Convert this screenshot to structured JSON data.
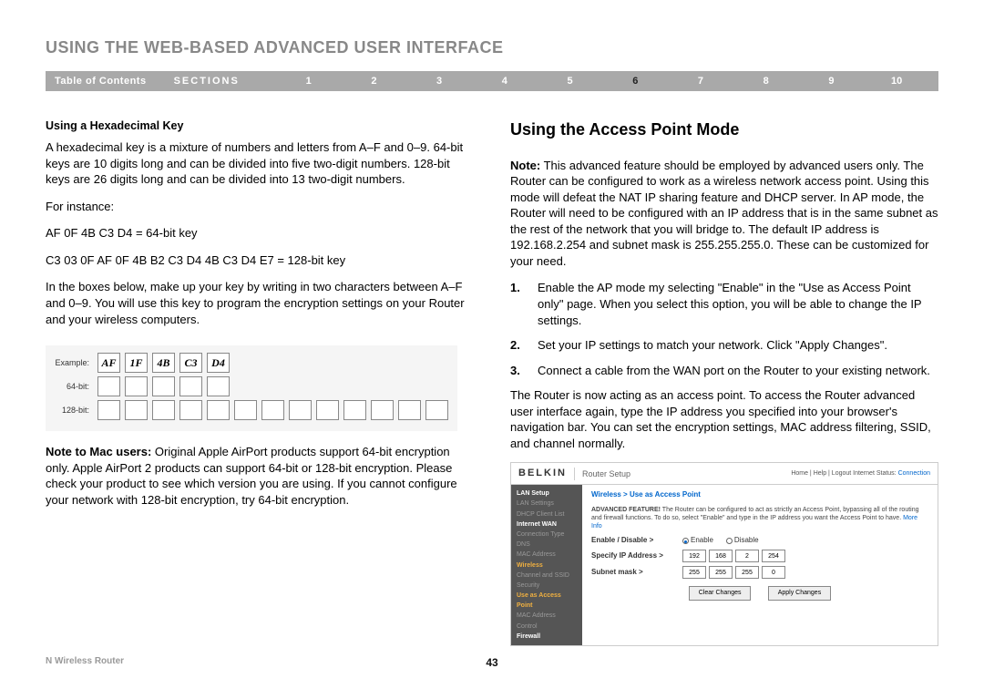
{
  "page_title": "USING THE WEB-BASED ADVANCED USER INTERFACE",
  "nav": {
    "toc": "Table of Contents",
    "sections_label": "SECTIONS",
    "items": [
      "1",
      "2",
      "3",
      "4",
      "5",
      "6",
      "7",
      "8",
      "9",
      "10"
    ],
    "active": "6"
  },
  "left": {
    "heading": "Using a Hexadecimal Key",
    "p1": "A hexadecimal key is a mixture of numbers and letters from A–F and 0–9. 64-bit keys are 10 digits long and can be divided into five two-digit numbers. 128-bit keys are 26 digits long and can be divided into 13 two-digit numbers.",
    "for_instance": "For instance:",
    "ex64": "AF 0F 4B C3 D4 = 64-bit key",
    "ex128": "C3 03 0F AF 0F 4B B2 C3 D4 4B C3 D4 E7 = 128-bit key",
    "p2": "In the boxes below, make up your key by writing in two characters between A–F and 0–9. You will use this key to program the encryption settings on your Router and your wireless computers.",
    "key_rows": {
      "example": {
        "label": "Example:",
        "vals": [
          "AF",
          "1F",
          "4B",
          "C3",
          "D4"
        ]
      },
      "bit64": {
        "label": "64-bit:",
        "count": 5
      },
      "bit128": {
        "label": "128-bit:",
        "count": 13
      }
    },
    "mac_bold": "Note to Mac users:",
    "mac_rest": " Original Apple AirPort products support 64-bit encryption only. Apple AirPort 2 products can support 64-bit or 128-bit encryption. Please check your product to see which version you are using. If you cannot configure your network with 128-bit encryption, try 64-bit encryption."
  },
  "right": {
    "heading": "Using the Access Point Mode",
    "note_bold": "Note:",
    "note_rest": " This advanced feature should be employed by advanced users only. The Router can be configured to work as a wireless network access point. Using this mode will defeat the NAT IP sharing feature and DHCP server. In AP mode, the Router will need to be configured with an IP address that is in the same subnet as the rest of the network that you will bridge to. The default IP address is 192.168.2.254 and subnet mask is 255.255.255.0. These can be customized for your need.",
    "steps": [
      {
        "n": "1.",
        "t": "Enable the AP mode my selecting \"Enable\" in the \"Use as Access Point only\" page. When you select this option, you will be able to change the IP settings."
      },
      {
        "n": "2.",
        "t": "Set your IP settings to match your network. Click \"Apply Changes\"."
      },
      {
        "n": "3.",
        "t": "Connect a cable from the WAN port on the Router to your existing network."
      }
    ],
    "p_after": "The Router is now acting as an access point. To access the Router advanced user interface again, type the IP address you specified into your browser's navigation bar. You can set the encryption settings, MAC address filtering, SSID, and channel normally."
  },
  "embed": {
    "brand": "BELKIN",
    "subtitle": "Router Setup",
    "top_right_links": "Home | Help | Logout   Internet Status:",
    "conn_status": "Connection",
    "sidebar": {
      "lan_setup": "LAN Setup",
      "lan_settings": "LAN Settings",
      "dhcp": "DHCP Client List",
      "internet_wan": "Internet WAN",
      "conn_type": "Connection Type",
      "dns": "DNS",
      "mac": "MAC Address",
      "wireless": "Wireless",
      "channel": "Channel and SSID",
      "security": "Security",
      "ap": "Use as Access Point",
      "wac": "MAC Address Control",
      "firewall": "Firewall"
    },
    "crumb": "Wireless > Use as Access Point",
    "adv_bold": "ADVANCED FEATURE!",
    "adv_rest": " The Router can be configured to act as strictly an Access Point, bypassing all of the routing and firewall functions. To do so, select \"Enable\" and type in the IP address you want the Access Point to have.",
    "more_info": "More Info",
    "row_enable_label": "Enable / Disable >",
    "row_enable_opt1": "Enable",
    "row_enable_opt2": "Disable",
    "row_ip_label": "Specify IP Address >",
    "ip": [
      "192",
      "168",
      "2",
      "254"
    ],
    "row_mask_label": "Subnet mask >",
    "mask": [
      "255",
      "255",
      "255",
      "0"
    ],
    "btn_clear": "Clear Changes",
    "btn_apply": "Apply Changes"
  },
  "footer": {
    "product": "N Wireless Router",
    "page": "43"
  }
}
